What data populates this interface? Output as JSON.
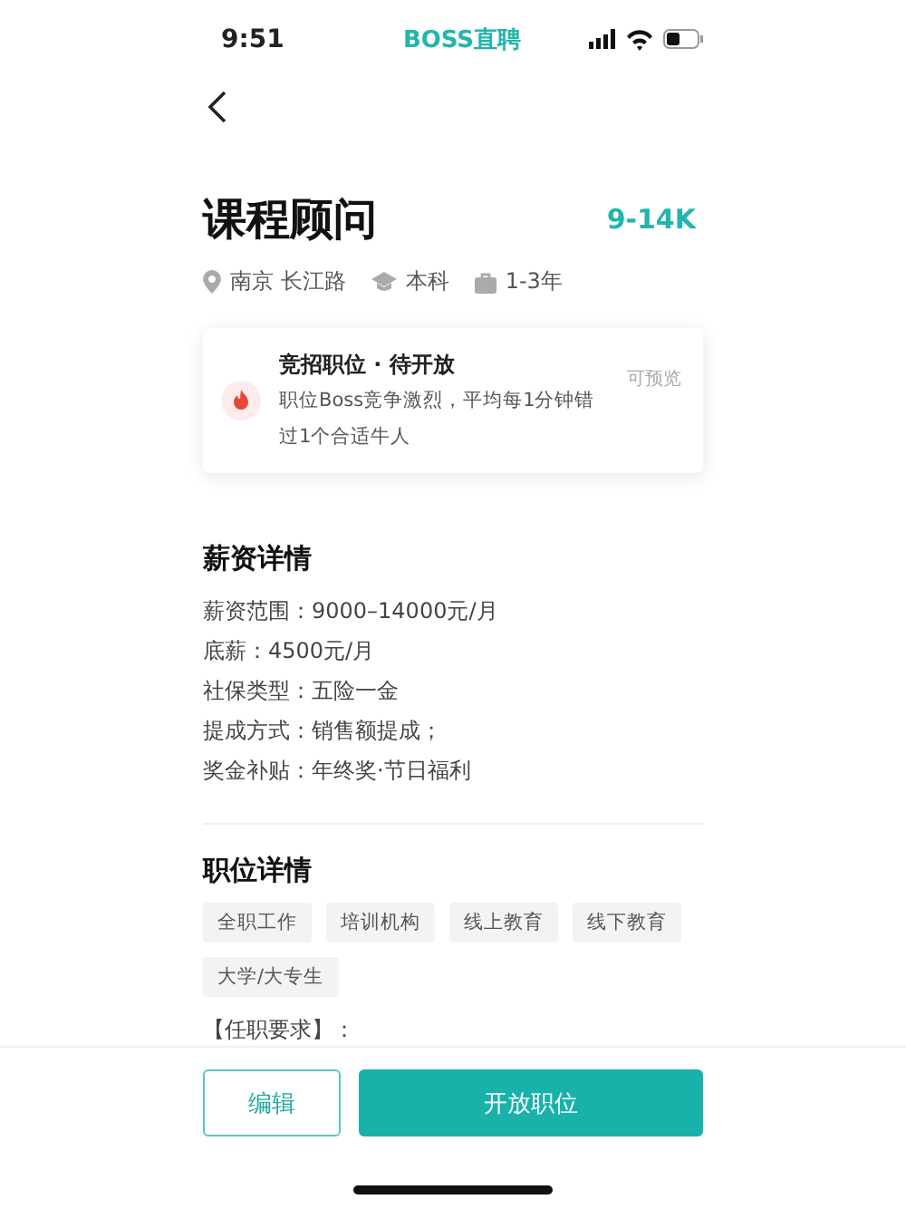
{
  "status_bar": {
    "time": "9:51",
    "app_name": "BOSS直聘"
  },
  "job": {
    "title": "课程顾问",
    "salary": "9-14K",
    "meta": [
      {
        "kind": "location",
        "text": "南京 长江路"
      },
      {
        "kind": "education",
        "text": "本科"
      },
      {
        "kind": "experience",
        "text": "1-3年"
      }
    ]
  },
  "notice": {
    "title": "竞招职位 · 待开放",
    "description": "职位Boss竞争激烈，平均每1分钟错过1个合适牛人",
    "action": "可预览"
  },
  "salary_section": {
    "heading": "薪资详情",
    "lines": [
      "薪资范围：9000–14000元/月",
      "底薪：4500元/月",
      "社保类型：五险一金",
      "提成方式：销售额提成；",
      "奖金补贴：年终奖·节日福利"
    ]
  },
  "job_section": {
    "heading": "职位详情",
    "tags": [
      "全职工作",
      "培训机构",
      "线上教育",
      "线下教育",
      "大学/大专生"
    ],
    "requirements_label": "【任职要求】："
  },
  "buttons": [
    {
      "kind": "outline",
      "label": "编辑"
    },
    {
      "kind": "primary",
      "label": "开放职位"
    }
  ]
}
